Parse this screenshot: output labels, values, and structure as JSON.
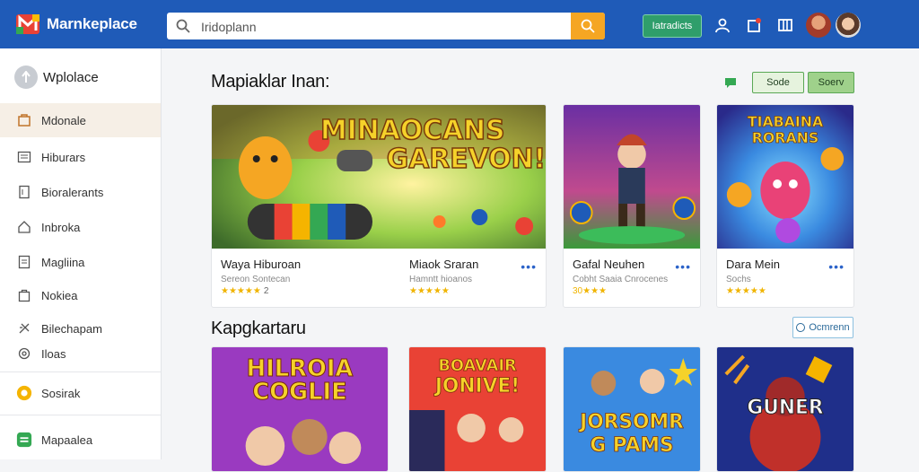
{
  "header": {
    "brand": "Marnkeplace",
    "search_value": "Iridoplann",
    "install_label": "Iatradicts"
  },
  "sidebar": {
    "head_label": "Wplolace",
    "items": [
      {
        "label": "Mdonale",
        "icon": "cart-icon"
      },
      {
        "label": "Hiburars",
        "icon": "list-icon"
      },
      {
        "label": "Bioralerants",
        "icon": "bookmark-icon"
      },
      {
        "label": "Inbroka",
        "icon": "home-icon"
      },
      {
        "label": "Magliina",
        "icon": "document-icon"
      },
      {
        "label": "Nokiea",
        "icon": "shopping-bag-icon"
      },
      {
        "label": "Bilechapam",
        "icon": "puzzle-icon"
      },
      {
        "label": "Iloas",
        "icon": "settings-icon"
      }
    ],
    "sosial_label": "Sosirak",
    "marketplace_label": "Mapaalea"
  },
  "featured": {
    "title": "Mapiaklar Inan:",
    "button_a": "Sode",
    "button_b": "Soerv",
    "cards": [
      {
        "art_text_1": "MINAOCANS",
        "art_text_2": "GAREVON!",
        "title": "Waya Hiburoan",
        "subtitle": "Sereon Sontecan",
        "rating_num": "2",
        "title2": "Miaok Sraran",
        "subtitle2": "Hamntt hioanos"
      },
      {
        "title": "Gafal Neuhen",
        "subtitle": "Cobht Saaia Cnrocenes",
        "rating_text": "30"
      },
      {
        "art_text_1": "TIABAINA",
        "art_text_2": "RORANS",
        "title": "Dara Mein",
        "subtitle": "Sochs"
      }
    ]
  },
  "categories": {
    "title": "Kapgkartaru",
    "button_label": "Ocmrenn",
    "cards": [
      {
        "art_text_1": "HILROIA",
        "art_text_2": "COGLIE"
      },
      {
        "art_text_1": "BOAVAIR",
        "art_text_2": "JONIVE!"
      },
      {
        "art_text_1": "JORSOMR",
        "art_text_2": "G PAMS"
      },
      {
        "art_text_1": "GUNER"
      }
    ]
  },
  "colors": {
    "header_bg": "#1f5bb8",
    "accent_orange": "#f5a623",
    "accent_green": "#2f9e6b"
  }
}
